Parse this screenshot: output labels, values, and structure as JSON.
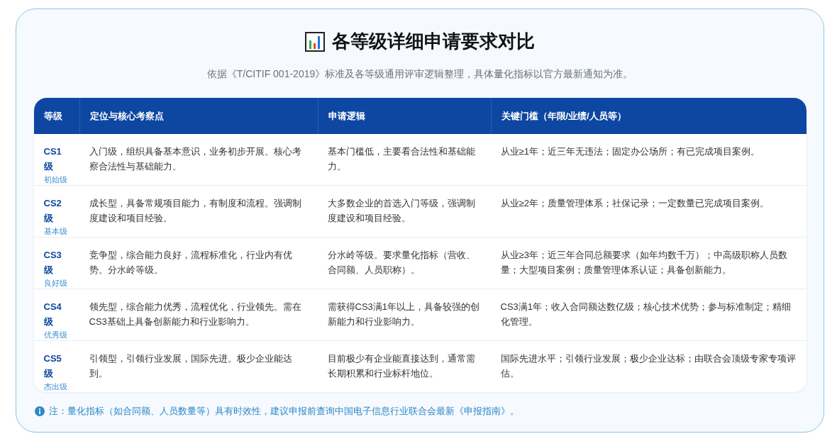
{
  "title": "各等级详细申请要求对比",
  "subtitle": "依据《T/CITIF 001-2019》标准及各等级通用评审逻辑整理，具体量化指标以官方最新通知为准。",
  "table": {
    "columns": [
      "等级",
      "定位与核心考察点",
      "申请逻辑",
      "关键门槛（年限/业绩/人员等）"
    ],
    "rows": [
      {
        "level": "CS1级",
        "level_name": "初始级",
        "positioning": "入门级，组织具备基本意识，业务初步开展。核心考察合法性与基础能力。",
        "logic": "基本门槛低，主要看合法性和基础能力。",
        "threshold": "从业≥1年；近三年无违法；固定办公场所；有已完成项目案例。"
      },
      {
        "level": "CS2级",
        "level_name": "基本级",
        "positioning": "成长型，具备常规项目能力，有制度和流程。强调制度建设和项目经验。",
        "logic": "大多数企业的首选入门等级，强调制度建设和项目经验。",
        "threshold": "从业≥2年；质量管理体系；社保记录；一定数量已完成项目案例。"
      },
      {
        "level": "CS3级",
        "level_name": "良好级",
        "positioning": "竞争型，综合能力良好，流程标准化，行业内有优势。分水岭等级。",
        "logic": "分水岭等级。要求量化指标（营收、合同额、人员职称）。",
        "threshold": "从业≥3年；近三年合同总额要求（如年均数千万）；中高级职称人员数量；大型项目案例；质量管理体系认证；具备创新能力。"
      },
      {
        "level": "CS4级",
        "level_name": "优秀级",
        "positioning": "领先型，综合能力优秀，流程优化，行业领先。需在CS3基础上具备创新能力和行业影响力。",
        "logic": "需获得CS3满1年以上，具备较强的创新能力和行业影响力。",
        "threshold": "CS3满1年；收入合同额达数亿级；核心技术优势；参与标准制定；精细化管理。"
      },
      {
        "level": "CS5级",
        "level_name": "杰出级",
        "positioning": "引领型，引领行业发展，国际先进。极少企业能达到。",
        "logic": "目前极少有企业能直接达到，通常需长期积累和行业标杆地位。",
        "threshold": "国际先进水平；引领行业发展；极少企业达标；由联合会顶级专家专项评估。"
      }
    ]
  },
  "note": "注：量化指标（如合同额、人员数量等）具有时效性，建议申报前查询中国电子信息行业联合会最新《申报指南》。"
}
